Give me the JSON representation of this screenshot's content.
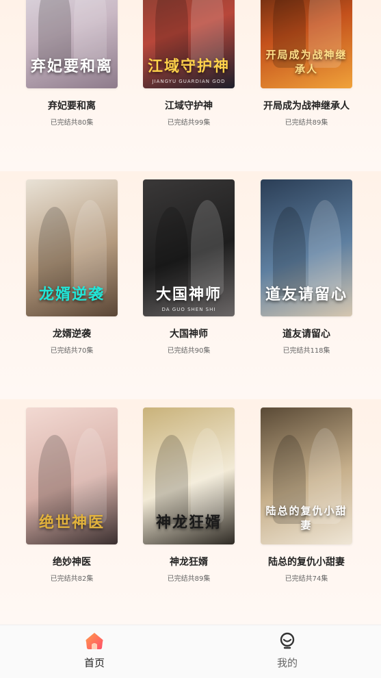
{
  "dramas": [
    {
      "title": "弃妃要和离",
      "episodes": "已完结共80集",
      "poster_text": "弃妃要和离",
      "poster_sub": "",
      "colors": [
        "#e8e8ee",
        "#c9b8c4",
        "#8e7b8b"
      ],
      "title_color": "#ffffff"
    },
    {
      "title": "江域守护神",
      "episodes": "已完结共99集",
      "poster_text": "江域守护神",
      "poster_sub": "JIANGYU GUARDIAN GOD",
      "colors": [
        "#6d3b2e",
        "#b8473a",
        "#1d1f2b"
      ],
      "title_color": "#ffd24a"
    },
    {
      "title": "开局成为战神继承人",
      "episodes": "已完结共89集",
      "poster_text": "开局成为战神继承人",
      "poster_sub": "",
      "colors": [
        "#2a1208",
        "#c4511c",
        "#f0a23a"
      ],
      "title_color": "#ffe08a"
    },
    {
      "title": "龙婿逆袭",
      "episodes": "已完结共70集",
      "poster_text": "龙婿逆袭",
      "poster_sub": "",
      "colors": [
        "#e9e2d6",
        "#b49a7e",
        "#5a4636"
      ],
      "title_color": "#22e6d8"
    },
    {
      "title": "大国神师",
      "episodes": "已完结共90集",
      "poster_text": "大国神师",
      "poster_sub": "DA GUO SHEN SHI",
      "colors": [
        "#3a3838",
        "#1e1e1e",
        "#6a6666"
      ],
      "title_color": "#ffffff"
    },
    {
      "title": "道友请留心",
      "episodes": "已完结共118集",
      "poster_text": "道友请留心",
      "poster_sub": "",
      "colors": [
        "#2b3e56",
        "#5e7fa0",
        "#d6c7b0"
      ],
      "title_color": "#ffffff"
    },
    {
      "title": "绝妙神医",
      "episodes": "已完结共82集",
      "poster_text": "绝世神医",
      "poster_sub": "",
      "colors": [
        "#f2d9d2",
        "#d7b0a8",
        "#3a2f2f"
      ],
      "title_color": "#e2b23c"
    },
    {
      "title": "神龙狂婿",
      "episodes": "已完结共89集",
      "poster_text": "神龙狂婿",
      "poster_sub": "",
      "colors": [
        "#c9b27a",
        "#f2ead6",
        "#2e2a24"
      ],
      "title_color": "#1a1a1a"
    },
    {
      "title": "陆总的复仇小甜妻",
      "episodes": "已完结共74集",
      "poster_text": "陆总的复仇小甜妻",
      "poster_sub": "",
      "colors": [
        "#5a4a36",
        "#c7b08c",
        "#efe6d6"
      ],
      "title_color": "#ffffff"
    }
  ],
  "tabbar": {
    "home_label": "首页",
    "mine_label": "我的",
    "active_color": "#222222",
    "inactive_color": "#666666",
    "home_icon": "house-icon",
    "mine_icon": "profile-icon"
  }
}
